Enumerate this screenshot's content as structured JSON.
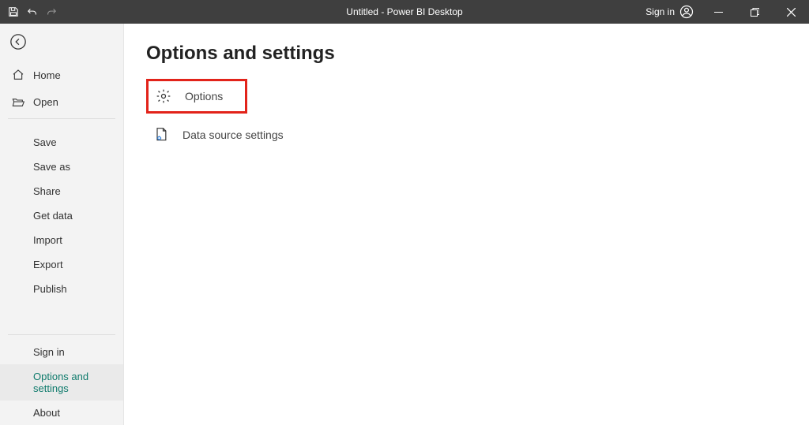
{
  "titlebar": {
    "title": "Untitled - Power BI Desktop",
    "sign_in": "Sign in"
  },
  "sidebar": {
    "primary": [
      {
        "label": "Home"
      },
      {
        "label": "Open"
      }
    ],
    "secondary": [
      {
        "label": "Save"
      },
      {
        "label": "Save as"
      },
      {
        "label": "Share"
      },
      {
        "label": "Get data"
      },
      {
        "label": "Import"
      },
      {
        "label": "Export"
      },
      {
        "label": "Publish"
      }
    ],
    "bottom": [
      {
        "label": "Sign in"
      },
      {
        "label": "Options and settings"
      },
      {
        "label": "About"
      }
    ]
  },
  "content": {
    "page_title": "Options and settings",
    "options_label": "Options",
    "datasource_label": "Data source settings"
  }
}
